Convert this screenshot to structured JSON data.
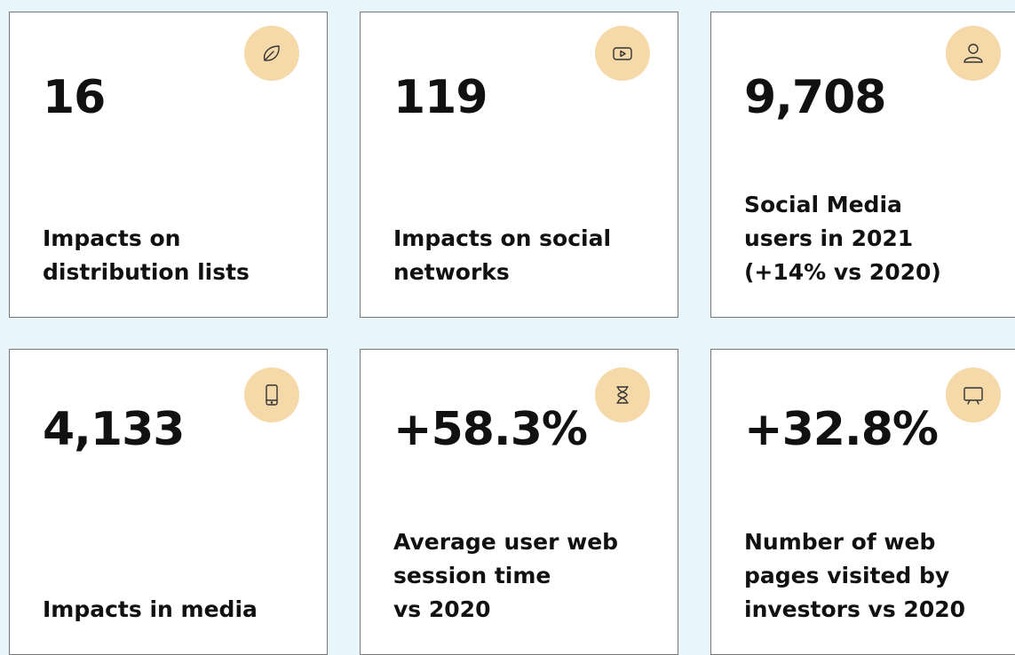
{
  "colors": {
    "background": "#e8f6fb",
    "card": "#ffffff",
    "card_border": "#777777",
    "icon_badge": "#f5d9a8",
    "text": "#111111"
  },
  "cards": [
    {
      "value": "16",
      "label": "Impacts on\ndistribution lists",
      "icon": "leaf-icon"
    },
    {
      "value": "119",
      "label": "Impacts on social\nnetworks",
      "icon": "video-play-icon"
    },
    {
      "value": "9,708",
      "label": "Social Media\nusers in 2021\n(+14% vs 2020)",
      "icon": "user-icon"
    },
    {
      "value": "4,133",
      "label": "Impacts in media",
      "icon": "smartphone-icon"
    },
    {
      "value": "+58.3%",
      "label": "Average user web\nsession time\nvs 2020",
      "icon": "hourglass-icon"
    },
    {
      "value": "+32.8%",
      "label": "Number of web\npages visited by\ninvestors vs 2020",
      "icon": "monitor-icon"
    }
  ]
}
